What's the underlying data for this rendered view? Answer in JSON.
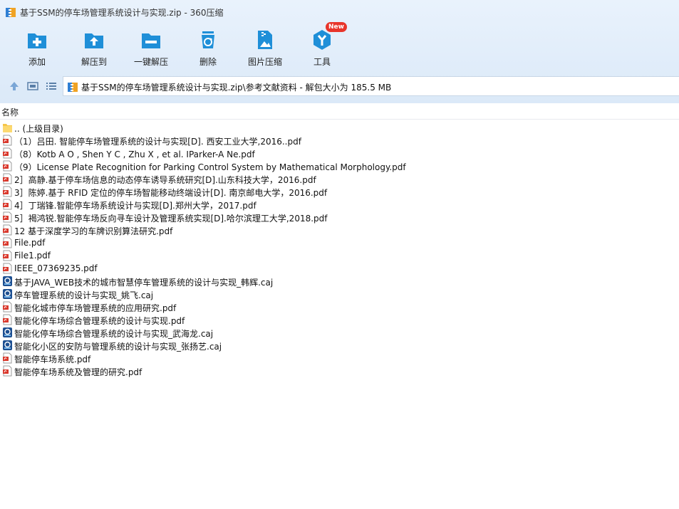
{
  "window": {
    "title": "基于SSM的停车场管理系统设计与实现.zip - 360压缩"
  },
  "colors": {
    "toolbar_icon": "#1f8fd8",
    "pdf": "#d9382c",
    "badge": "#e8352b",
    "header_bg": "#dbe9f8"
  },
  "toolbar": [
    {
      "label": "添加",
      "icon": "add-icon"
    },
    {
      "label": "解压到",
      "icon": "extract-to-icon"
    },
    {
      "label": "一键解压",
      "icon": "one-click-extract-icon"
    },
    {
      "label": "删除",
      "icon": "delete-icon"
    },
    {
      "label": "图片压缩",
      "icon": "image-compress-icon"
    },
    {
      "label": "工具",
      "icon": "tools-icon",
      "badge": "New"
    }
  ],
  "navigation": {
    "path": "基于SSM的停车场管理系统设计与实现.zip\\参考文献资料 - 解包大小为 185.5 MB"
  },
  "list": {
    "column_name": "名称",
    "items": [
      {
        "name": ".. (上级目录)",
        "type": "folder"
      },
      {
        "name": "（1）吕田. 智能停车场管理系统的设计与实现[D]. 西安工业大学,2016..pdf",
        "type": "pdf"
      },
      {
        "name": "（8）Kotb A O , Shen Y C , Zhu X , et al. IParker-A Ne.pdf",
        "type": "pdf"
      },
      {
        "name": "（9）License Plate Recognition for Parking Control System by Mathematical Morphology.pdf",
        "type": "pdf"
      },
      {
        "name": "2］高静.基于停车场信息的动态停车诱导系统研究[D].山东科技大学，2016.pdf",
        "type": "pdf"
      },
      {
        "name": "3］陈婷.基于 RFID 定位的停车场智能移动终端设计[D]. 南京邮电大学，2016.pdf",
        "type": "pdf"
      },
      {
        "name": "4］丁瑞锋.智能停车场系统设计与实现[D].郑州大学，2017.pdf",
        "type": "pdf"
      },
      {
        "name": "5］褐鸿锐.智能停车场反向寻车设计及管理系统实现[D].哈尔滨理工大学,2018.pdf",
        "type": "pdf"
      },
      {
        "name": "12 基于深度学习的车牌识别算法研究.pdf",
        "type": "pdf"
      },
      {
        "name": "File.pdf",
        "type": "pdf"
      },
      {
        "name": "File1.pdf",
        "type": "pdf"
      },
      {
        "name": "IEEE_07369235.pdf",
        "type": "pdf"
      },
      {
        "name": "基于JAVA_WEB技术的城市智慧停车管理系统的设计与实现_韩辉.caj",
        "type": "caj"
      },
      {
        "name": "停车管理系统的设计与实现_姚飞.caj",
        "type": "caj"
      },
      {
        "name": "智能化城市停车场管理系统的应用研究.pdf",
        "type": "pdf"
      },
      {
        "name": "智能化停车场综合管理系统的设计与实现.pdf",
        "type": "pdf"
      },
      {
        "name": "智能化停车场综合管理系统的设计与实现_武海龙.caj",
        "type": "caj"
      },
      {
        "name": "智能化小区的安防与管理系统的设计与实现_张扬艺.caj",
        "type": "caj"
      },
      {
        "name": "智能停车场系统.pdf",
        "type": "pdf"
      },
      {
        "name": "智能停车场系统及管理的研究.pdf",
        "type": "pdf"
      }
    ]
  }
}
